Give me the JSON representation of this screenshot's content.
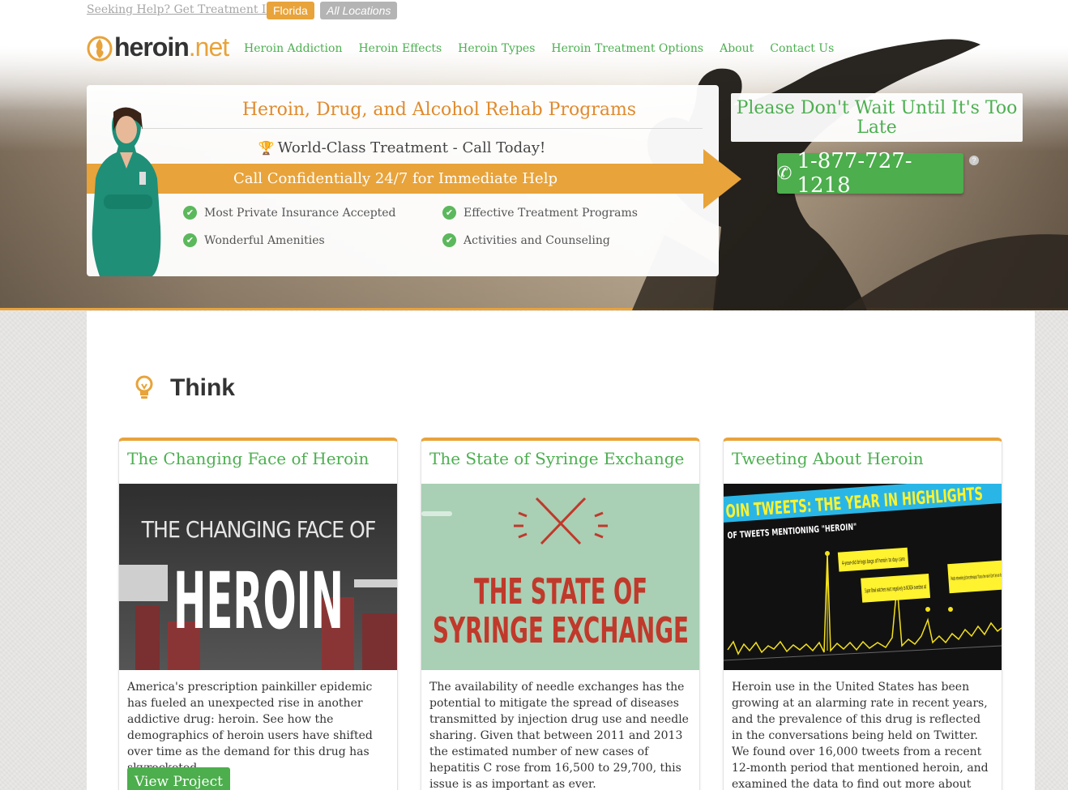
{
  "topbar": {
    "seeking": "Seeking Help? Get Treatment In:",
    "florida": "Florida",
    "all_locations": "All Locations"
  },
  "logo": {
    "name": "heroin",
    "tld": ".net"
  },
  "nav": {
    "items": [
      {
        "label": "Heroin Addiction"
      },
      {
        "label": "Heroin Effects"
      },
      {
        "label": "Heroin Types"
      },
      {
        "label": "Heroin Treatment Options"
      },
      {
        "label": "About"
      },
      {
        "label": "Contact Us"
      }
    ]
  },
  "hero": {
    "title": "Heroin, Drug, and Alcohol Rehab Programs",
    "subtitle": "World-Class Treatment - Call Today!",
    "band": "Call Confidentially 24/7 for Immediate Help",
    "checks": [
      "Most Private Insurance Accepted",
      "Effective Treatment Programs",
      "Wonderful Amenities",
      "Activities and Counseling"
    ],
    "cta_text": "Please Don't Wait Until It's Too Late",
    "phone": "1-877-727-1218",
    "help": "?"
  },
  "section": {
    "title": "Think"
  },
  "cards": [
    {
      "title": "The Changing Face of Heroin",
      "img_line1": "THE CHANGING FACE OF",
      "img_line2": "HEROIN",
      "text": "America's prescription painkiller epidemic has fueled an unexpected rise in another addictive drug: heroin. See how the demographics of heroin users have shifted over time as the demand for this drug has skyrocketed.",
      "button": "View Project"
    },
    {
      "title": "The State of Syringe Exchange",
      "img_line1": "THE STATE OF",
      "img_line2": "SYRINGE EXCHANGE",
      "text": "The availability of needle exchanges has the potential to mitigate the spread of diseases transmitted by injection drug use and needle sharing. Given that between 2011 and 2013 the estimated number of new cases of hepatitis C rose from 16,500 to 29,700, this issue is as important as ever."
    },
    {
      "title": "Tweeting About Heroin",
      "img_title": "OIN TWEETS: THE YEAR IN HIGHLIGHTS",
      "img_sub": "OF TWEETS MENTIONING \"HEROIN\"",
      "img_note1": "4-year-old brings bags of heroin to day care",
      "img_note2": "Super Bowl watchers react negatively to NCADA overdose ad",
      "img_note3": "People retweeting @chancetherappe \"Xanax the new H Don't let em fool",
      "text": "Heroin use in the United States has been growing at an alarming rate in recent years, and the prevalence of this drug is reflected in the conversations being held on Twitter. We found over 16,000 tweets from a recent 12-month period that mentioned heroin, and examined the data to find out more about who these people are"
    }
  ],
  "colors": {
    "accent_orange": "#e8a33a",
    "green": "#4caf50",
    "button_green": "#4cae4c"
  }
}
